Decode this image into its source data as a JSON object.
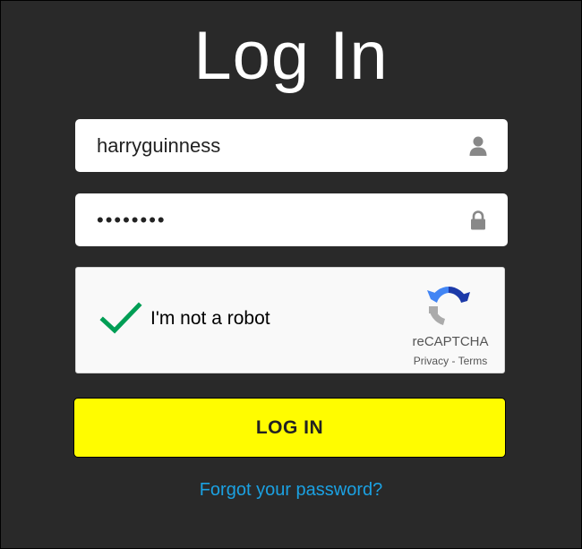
{
  "title": "Log In",
  "username": {
    "value": "harryguinness",
    "icon": "user-icon"
  },
  "password": {
    "value": "••••••••",
    "icon": "lock-icon"
  },
  "captcha": {
    "label": "I'm not a robot",
    "checked": true,
    "brand": "reCAPTCHA",
    "privacy_link": "Privacy",
    "separator": " - ",
    "terms_link": "Terms"
  },
  "login_button": "LOG IN",
  "forgot_password": "Forgot your password?",
  "colors": {
    "background": "#292929",
    "button": "#fffc00",
    "link": "#1ba1e2",
    "check": "#009e55"
  }
}
